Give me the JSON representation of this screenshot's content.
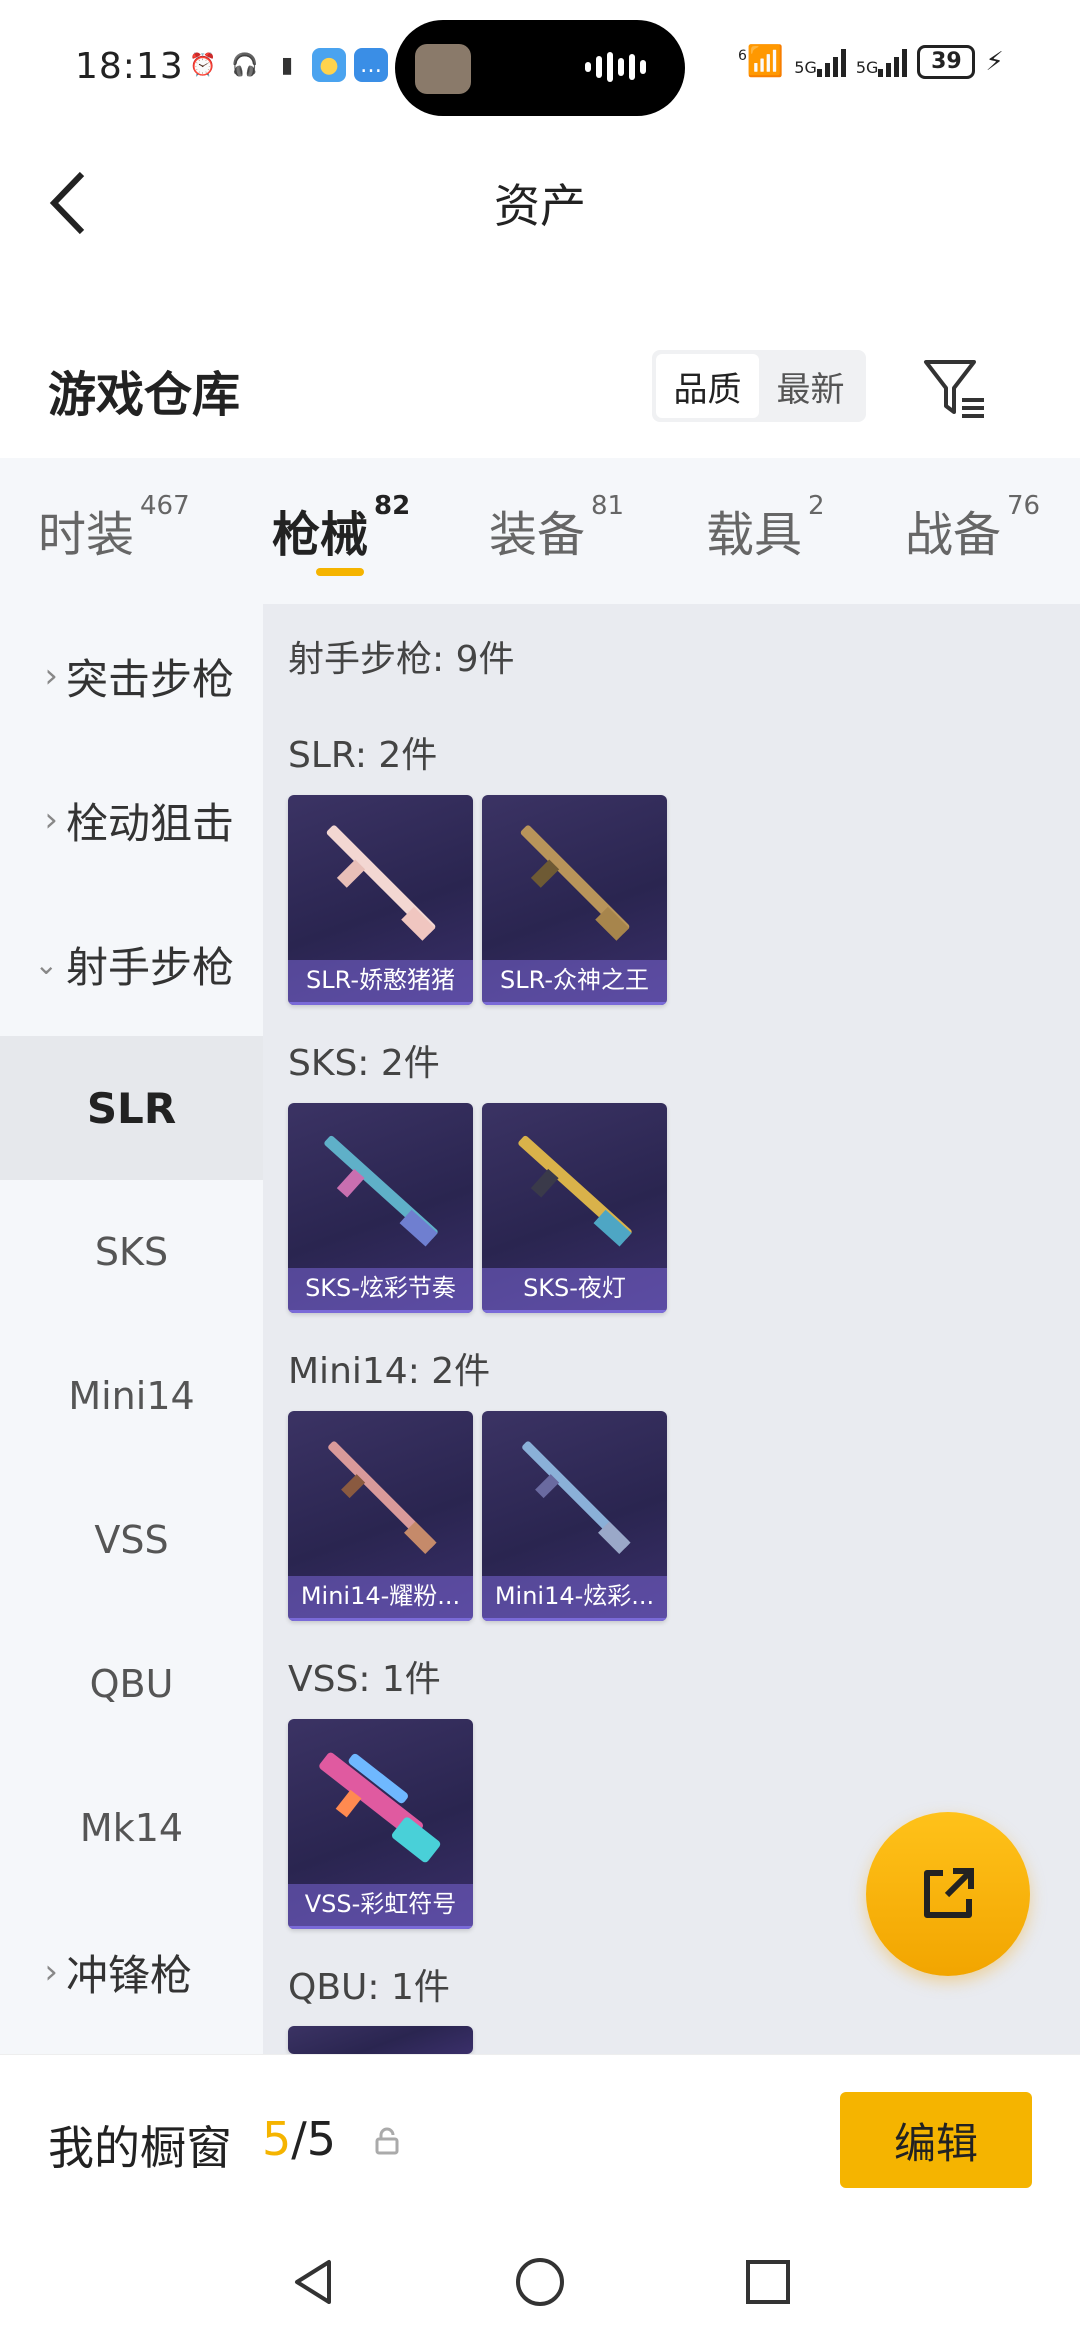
{
  "status_bar": {
    "time": "18:13",
    "battery": "39",
    "network_1": "5G",
    "network_2": "5G",
    "wifi_badge": "6"
  },
  "header": {
    "back_icon": "chevron-left-icon",
    "title": "资产"
  },
  "warehouse": {
    "title": "游戏仓库",
    "sort_options": [
      "品质",
      "最新"
    ],
    "sort_selected": "品质",
    "filter_icon": "filter-icon"
  },
  "tabs": [
    {
      "label": "时装",
      "count": "467"
    },
    {
      "label": "枪械",
      "count": "82",
      "active": true
    },
    {
      "label": "装备",
      "count": "81"
    },
    {
      "label": "载具",
      "count": "2"
    },
    {
      "label": "战备",
      "count": "76"
    }
  ],
  "sidebar": {
    "groups": [
      {
        "label": "突击步枪",
        "expanded": false
      },
      {
        "label": "栓动狙击",
        "expanded": false
      },
      {
        "label": "射手步枪",
        "expanded": true
      }
    ],
    "subitems": [
      {
        "label": "SLR",
        "selected": true
      },
      {
        "label": "SKS"
      },
      {
        "label": "Mini14"
      },
      {
        "label": "VSS"
      },
      {
        "label": "QBU"
      },
      {
        "label": "Mk14"
      }
    ],
    "after_group": {
      "label": "冲锋枪",
      "expanded": false
    }
  },
  "content": {
    "summary": "射手步枪: 9件",
    "sections": [
      {
        "title": "SLR: 2件",
        "items": [
          "SLR-娇憨猪猪",
          "SLR-众神之王"
        ]
      },
      {
        "title": "SKS: 2件",
        "items": [
          "SKS-炫彩节奏",
          "SKS-夜灯"
        ]
      },
      {
        "title": "Mini14: 2件",
        "items": [
          "Mini14-耀粉...",
          "Mini14-炫彩..."
        ]
      },
      {
        "title": "VSS: 1件",
        "items": [
          "VSS-彩虹符号"
        ]
      },
      {
        "title": "QBU: 1件",
        "items": []
      }
    ]
  },
  "fab": {
    "icon": "share-icon"
  },
  "showcase": {
    "label": "我的橱窗",
    "current": "5",
    "separator": "/",
    "total": "5",
    "edit_label": "编辑"
  },
  "nav": {
    "icons": [
      "back-triangle-icon",
      "home-circle-icon",
      "recents-square-icon"
    ]
  },
  "colors": {
    "accent": "#f5b400",
    "card_bg": "#2a2550",
    "card_label": "#7a6ad8"
  }
}
